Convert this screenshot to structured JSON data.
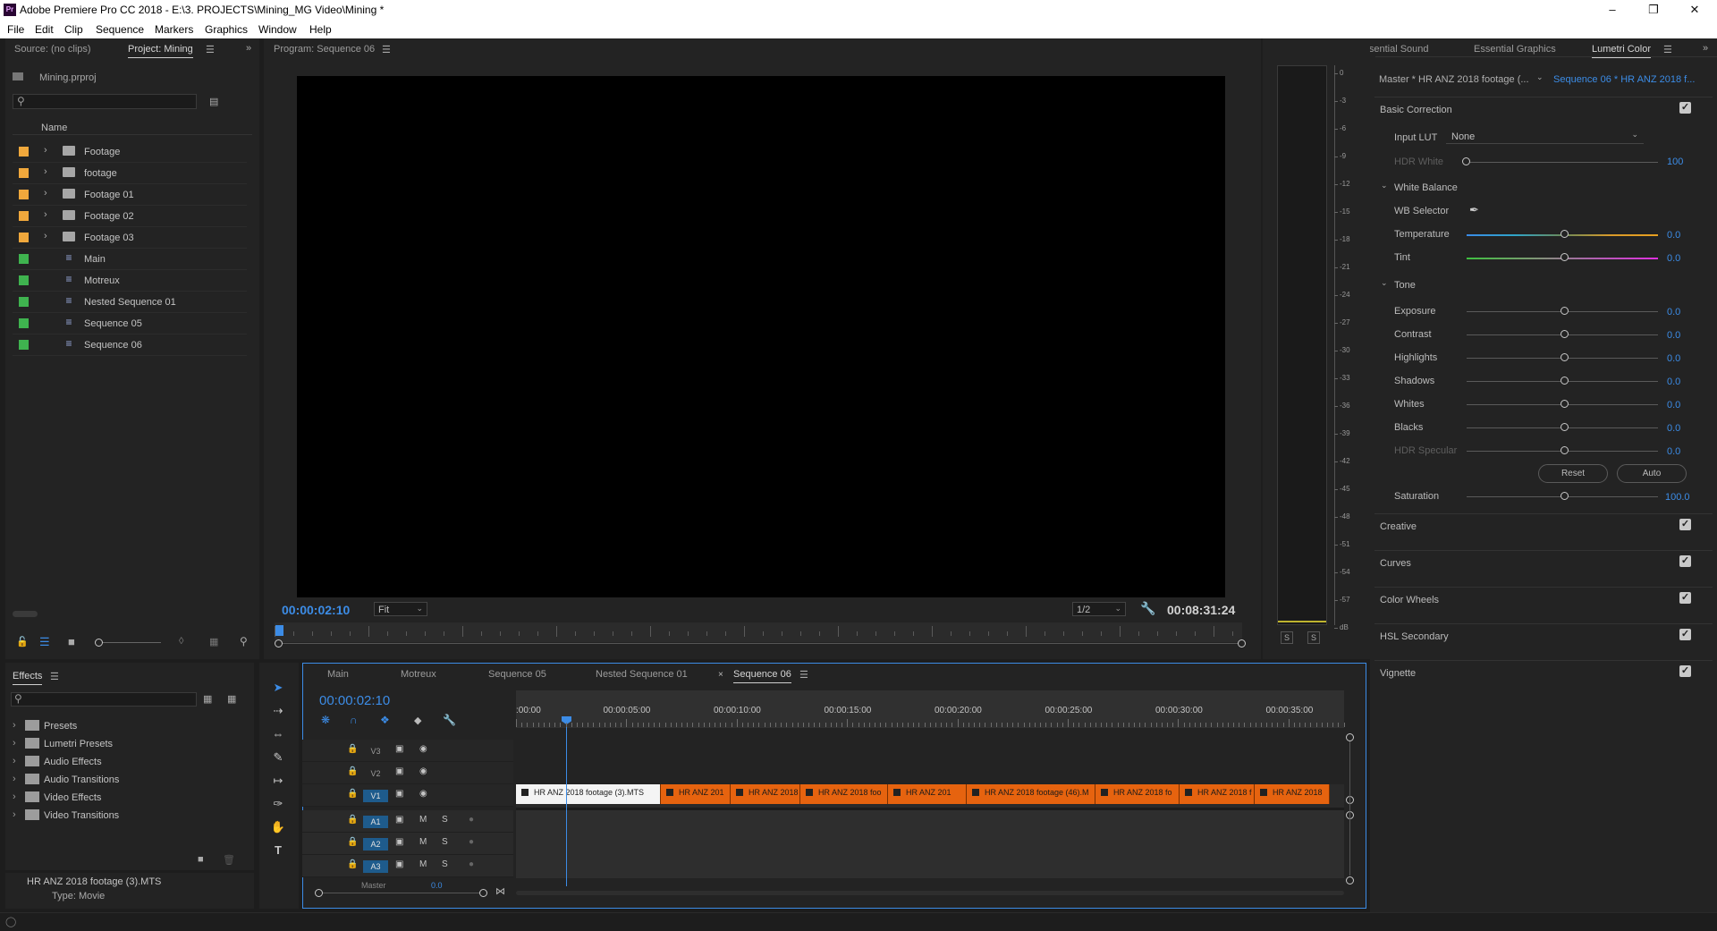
{
  "window": {
    "title": "Adobe Premiere Pro CC 2018 - E:\\3. PROJECTS\\Mining_MG Video\\Mining *",
    "app_badge": "Pr"
  },
  "menu": [
    "File",
    "Edit",
    "Clip",
    "Sequence",
    "Markers",
    "Graphics",
    "Window",
    "Help"
  ],
  "project_panel": {
    "tab_source": "Source: (no clips)",
    "tab_project": "Project: Mining",
    "project_file": "Mining.prproj",
    "column_name": "Name",
    "items": [
      {
        "name": "Footage",
        "type": "folder",
        "color": "#f0a83c"
      },
      {
        "name": "footage",
        "type": "folder",
        "color": "#f0a83c"
      },
      {
        "name": "Footage 01",
        "type": "folder",
        "color": "#f0a83c"
      },
      {
        "name": "Footage 02",
        "type": "folder",
        "color": "#f0a83c"
      },
      {
        "name": "Footage 03",
        "type": "folder",
        "color": "#f0a83c"
      },
      {
        "name": "Main",
        "type": "sequence",
        "color": "#3fb34f"
      },
      {
        "name": "Motreux",
        "type": "sequence",
        "color": "#3fb34f"
      },
      {
        "name": "Nested Sequence 01",
        "type": "sequence",
        "color": "#3fb34f"
      },
      {
        "name": "Sequence 05",
        "type": "sequence",
        "color": "#3fb34f"
      },
      {
        "name": "Sequence 06",
        "type": "sequence",
        "color": "#3fb34f"
      }
    ]
  },
  "program_monitor": {
    "tab": "Program: Sequence 06",
    "timecode": "00:00:02:10",
    "fit": "Fit",
    "resolution": "1/2",
    "duration": "00:08:31:24"
  },
  "audio_meter": {
    "scale": [
      "0",
      "-3",
      "-6",
      "-9",
      "-12",
      "-15",
      "-18",
      "-21",
      "-24",
      "-27",
      "-30",
      "-33",
      "-36",
      "-39",
      "-42",
      "-45",
      "-48",
      "-51",
      "-54",
      "-57",
      "dB"
    ],
    "solo_labels": [
      "S",
      "S"
    ]
  },
  "lumetri": {
    "tabs": [
      "Essential Sound",
      "Essential Graphics",
      "Lumetri Color"
    ],
    "master_clip": "Master * HR ANZ 2018 footage (...",
    "sequence_clip": "Sequence 06 * HR ANZ 2018 f...",
    "basic_correction": "Basic Correction",
    "input_lut_label": "Input LUT",
    "input_lut_value": "None",
    "hdr_white_label": "HDR White",
    "hdr_white_value": "100",
    "white_balance": "White Balance",
    "wb_selector": "WB Selector",
    "temperature": {
      "label": "Temperature",
      "value": "0.0"
    },
    "tint": {
      "label": "Tint",
      "value": "0.0"
    },
    "tone": "Tone",
    "tone_sliders": [
      {
        "label": "Exposure",
        "value": "0.0"
      },
      {
        "label": "Contrast",
        "value": "0.0"
      },
      {
        "label": "Highlights",
        "value": "0.0"
      },
      {
        "label": "Shadows",
        "value": "0.0"
      },
      {
        "label": "Whites",
        "value": "0.0"
      },
      {
        "label": "Blacks",
        "value": "0.0"
      },
      {
        "label": "HDR Specular",
        "value": "0.0"
      }
    ],
    "reset": "Reset",
    "auto": "Auto",
    "saturation": {
      "label": "Saturation",
      "value": "100.0"
    },
    "sections": [
      "Creative",
      "Curves",
      "Color Wheels",
      "HSL Secondary",
      "Vignette"
    ]
  },
  "effects_panel": {
    "tab": "Effects",
    "items": [
      "Presets",
      "Lumetri Presets",
      "Audio Effects",
      "Audio Transitions",
      "Video Effects",
      "Video Transitions"
    ],
    "info_clip": "HR ANZ 2018 footage (3).MTS",
    "info_type": "Type: Movie"
  },
  "timeline": {
    "tabs": [
      "Main",
      "Motreux",
      "Sequence 05",
      "Nested Sequence 01",
      "Sequence 06"
    ],
    "timecode": "00:00:02:10",
    "ruler": [
      ":00:00",
      "00:00:05:00",
      "00:00:10:00",
      "00:00:15:00",
      "00:00:20:00",
      "00:00:25:00",
      "00:00:30:00",
      "00:00:35:00"
    ],
    "tracks": [
      {
        "name": "V3",
        "buttons": [
          "",
          ""
        ]
      },
      {
        "name": "V2",
        "buttons": [
          "",
          ""
        ]
      },
      {
        "name": "V1",
        "buttons": [
          "",
          ""
        ]
      },
      {
        "name": "A1",
        "buttons": [
          "M",
          "S"
        ]
      },
      {
        "name": "A2",
        "buttons": [
          "M",
          "S"
        ]
      },
      {
        "name": "A3",
        "buttons": [
          "M",
          "S"
        ]
      }
    ],
    "master_label": "Master",
    "master_value": "0.0",
    "clips": [
      {
        "label": "HR ANZ 2018 footage (3).MTS",
        "selected": true
      },
      {
        "label": "HR ANZ 201",
        "selected": false
      },
      {
        "label": "HR ANZ 2018 fo",
        "selected": false
      },
      {
        "label": "HR ANZ 2018 foo",
        "selected": false
      },
      {
        "label": "HR ANZ 201",
        "selected": false
      },
      {
        "label": "HR ANZ 2018 footage (46).M",
        "selected": false
      },
      {
        "label": "HR ANZ 2018 fo",
        "selected": false
      },
      {
        "label": "HR ANZ 2018 f",
        "selected": false
      },
      {
        "label": "HR ANZ 2018",
        "selected": false
      }
    ]
  },
  "colors": {
    "accent": "#3c8ce6",
    "clip": "#e6630f",
    "selected_clip": "#ffffff"
  }
}
